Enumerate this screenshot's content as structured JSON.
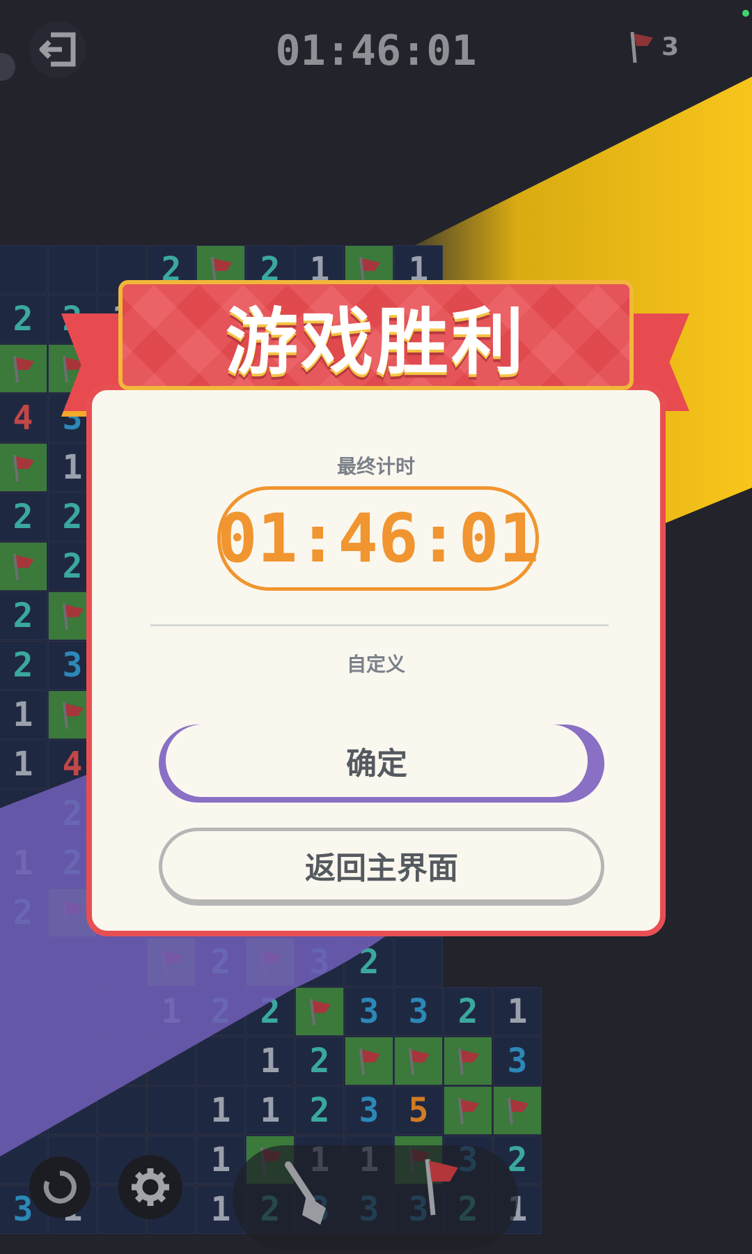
{
  "topbar": {
    "timer": "01:46:01",
    "flags_remaining": "3"
  },
  "board": {
    "rows": [
      [
        "",
        "",
        "",
        "2",
        "F",
        "2",
        "1",
        "F",
        "1"
      ],
      [
        "2",
        "2",
        "1",
        "",
        "",
        "",
        "",
        "",
        ""
      ],
      [
        "F",
        "F",
        "",
        "",
        "",
        "",
        "",
        "",
        ""
      ],
      [
        "4",
        "3",
        "",
        "",
        "",
        "",
        "",
        "",
        ""
      ],
      [
        "F",
        "1",
        "",
        "",
        "",
        "",
        "",
        "",
        ""
      ],
      [
        "2",
        "2",
        "",
        "",
        "",
        "",
        "",
        "",
        ""
      ],
      [
        "F",
        "2",
        "",
        "",
        "",
        "",
        "",
        "",
        ""
      ],
      [
        "2",
        "F",
        "",
        "",
        "",
        "",
        "",
        "",
        ""
      ],
      [
        "2",
        "3",
        "",
        "",
        "",
        "",
        "",
        "",
        ""
      ],
      [
        "1",
        "F",
        "",
        "",
        "",
        "",
        "",
        "",
        ""
      ],
      [
        "1",
        "4",
        "",
        "",
        "",
        "",
        "",
        "",
        ""
      ],
      [
        "",
        "2",
        "",
        "",
        "",
        "",
        "",
        "",
        ""
      ],
      [
        "1",
        "2",
        "",
        "",
        "",
        "",
        "",
        "",
        ""
      ],
      [
        "2",
        "F",
        "",
        "",
        "",
        "",
        "",
        "",
        ""
      ],
      [
        "",
        "",
        "",
        "F",
        "2",
        "F",
        "3",
        "2",
        ""
      ],
      [
        "",
        "",
        "",
        "1",
        "2",
        "2",
        "F",
        "3",
        "3",
        "2",
        "1"
      ],
      [
        "",
        "",
        "",
        "",
        "",
        "1",
        "2",
        "F",
        "F",
        "F",
        "3"
      ],
      [
        "",
        "",
        "",
        "",
        "1",
        "1",
        "2",
        "3",
        "5",
        "F",
        "F"
      ],
      [
        "",
        "",
        "",
        "",
        "1",
        "F",
        "1",
        "1",
        "F",
        "3",
        "2"
      ],
      [
        "3",
        "1",
        "",
        "",
        "1",
        "2",
        "3",
        "3",
        "3",
        "2",
        "1"
      ]
    ]
  },
  "dialog": {
    "title": "游戏胜利",
    "final_time_label": "最终计时",
    "final_time": "01:46:01",
    "mode": "自定义",
    "confirm_label": "确定",
    "home_label": "返回主界面"
  },
  "tools": {
    "icons": [
      "undo-icon",
      "gear-icon",
      "shovel-icon",
      "flag-icon"
    ]
  },
  "colors": {
    "banner_red": "#e84b50",
    "accent_orange": "#f09530",
    "accent_yellow": "#f6c21a",
    "accent_purple": "#6f5db5",
    "flag_green": "#3b7a3a"
  }
}
